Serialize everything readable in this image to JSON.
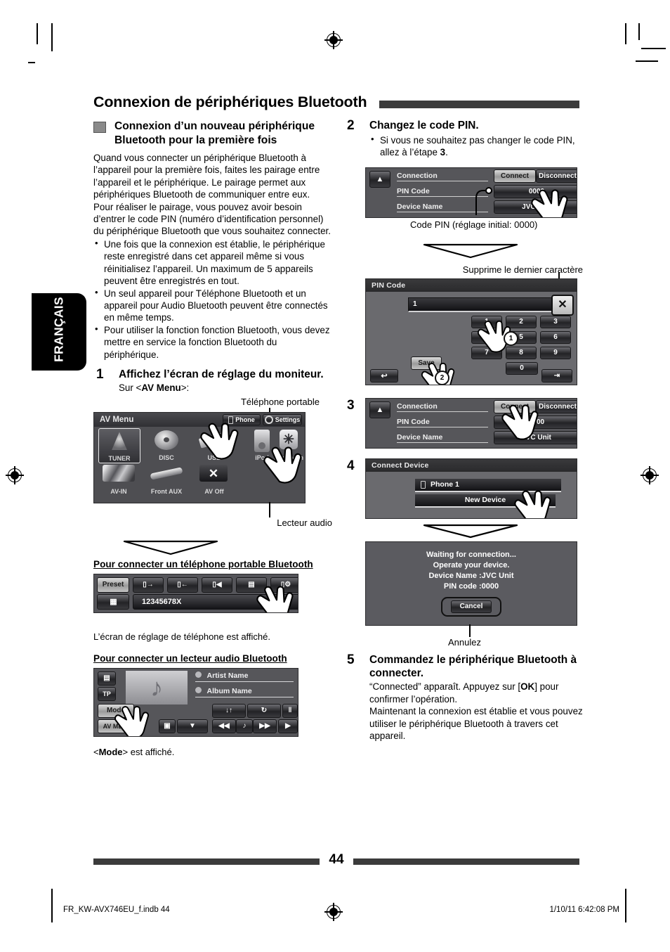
{
  "document": {
    "chapter_title": "Connexion de périphériques Bluetooth",
    "language_tab": "FRANÇAIS",
    "page_number": "44",
    "footer_left": "FR_KW-AVX746EU_f.indb   44",
    "footer_right": "1/10/11   6:42:08 PM"
  },
  "left_column": {
    "section_heading": "Connexion d’un nouveau périphérique Bluetooth pour la première fois",
    "intro": "Quand vous connecter un périphérique Bluetooth à l’appareil pour la première fois, faites les pairage entre l’appareil et le périphérique. Le pairage permet aux périphériques Bluetooth de communiquer entre eux. Pour réaliser le pairage, vous pouvez avoir besoin d’entrer le code PIN (numéro d’identification personnel) du périphérique Bluetooth que vous souhaitez connecter.",
    "bullets": [
      "Une fois que la connexion est établie, le périphérique reste enregistré dans cet appareil même si vous réinitialisez l’appareil. Un maximum de 5 appareils peuvent être enregistrés en tout.",
      "Un seul appareil pour Téléphone Bluetooth et un appareil pour Audio Bluetooth peuvent être connectés en même temps.",
      "Pour utiliser la fonction fonction Bluetooth, vous devez mettre en service la fonction Bluetooth du périphérique."
    ],
    "step1": {
      "number": "1",
      "title": "Affichez l’écran de réglage du moniteur.",
      "body_prefix": "Sur <",
      "body_bold": "AV Menu",
      "body_suffix": ">:"
    },
    "av_menu_screen": {
      "title": "AV Menu",
      "phone_button": "Phone",
      "settings_button": "Settings",
      "sources": [
        "TUNER",
        "DISC",
        "USB",
        "iPod",
        "Bluetooth",
        "AV-IN",
        "Front AUX",
        "AV Off"
      ],
      "callout_top": "Téléphone portable",
      "callout_bottom": "Lecteur audio"
    },
    "phone_section": {
      "heading": "Pour connecter un téléphone portable Bluetooth",
      "preset_label": "Preset",
      "number_display": "12345678X",
      "caption": "L’écran de réglage de téléphone est affiché."
    },
    "audio_section": {
      "heading": "Pour connecter un lecteur audio Bluetooth",
      "tp_label": "TP",
      "mode_label": "Mode",
      "avmenu_label": "AV MENU",
      "artist_name": "Artist Name",
      "album_name": "Album Name",
      "caption_prefix": "<",
      "caption_bold": "Mode",
      "caption_suffix": "> est affiché."
    }
  },
  "right_column": {
    "step2": {
      "number": "2",
      "title": "Changez le code PIN.",
      "bullet_prefix": "Si vous ne souhaitez pas changer le code PIN, allez à l’étape ",
      "bullet_bold": "3",
      "bullet_suffix": "."
    },
    "connection_screen": {
      "rows": [
        "Connection",
        "PIN Code",
        "Device Name"
      ],
      "connect_button": "Connect",
      "disconnect_button": "Disconnect",
      "pin_value": "0000",
      "device_value": "JVC Unit",
      "callout": "Code PIN (réglage initial: 0000)"
    },
    "pin_screen": {
      "title": "PIN Code",
      "entry_value": "1",
      "keys": [
        "1",
        "2",
        "3",
        "4",
        "5",
        "6",
        "7",
        "8",
        "9",
        "0"
      ],
      "save_button": "Save",
      "marker1": "1",
      "marker2": "2",
      "callout_delete": "Supprime le dernier caractère"
    },
    "step3": {
      "number": "3"
    },
    "connection_screen3": {
      "rows": [
        "Connection",
        "PIN Code",
        "Device Name"
      ],
      "connect_button": "Connect",
      "disconnect_button": "Disconnect",
      "pin_value": "0000",
      "device_value": "JVC Unit"
    },
    "step4": {
      "number": "4"
    },
    "connect_device_screen": {
      "title": "Connect Device",
      "items": [
        "Phone 1",
        "New Device"
      ]
    },
    "waiting_screen": {
      "line1": "Waiting for connection...",
      "line2": "Operate your device.",
      "line3": "Device Name :JVC Unit",
      "line4": "PIN code :0000",
      "cancel_button": "Cancel",
      "callout": "Annulez"
    },
    "step5": {
      "number": "5",
      "title": "Commandez le périphérique Bluetooth à connecter.",
      "body_part1": "“Connected” apparaît. Appuyez sur [",
      "body_bold": "OK",
      "body_part2": "] pour confirmer l’opération.",
      "body_part3": "Maintenant la connexion est établie et vous pouvez utiliser le périphérique Bluetooth à travers cet appareil."
    }
  }
}
